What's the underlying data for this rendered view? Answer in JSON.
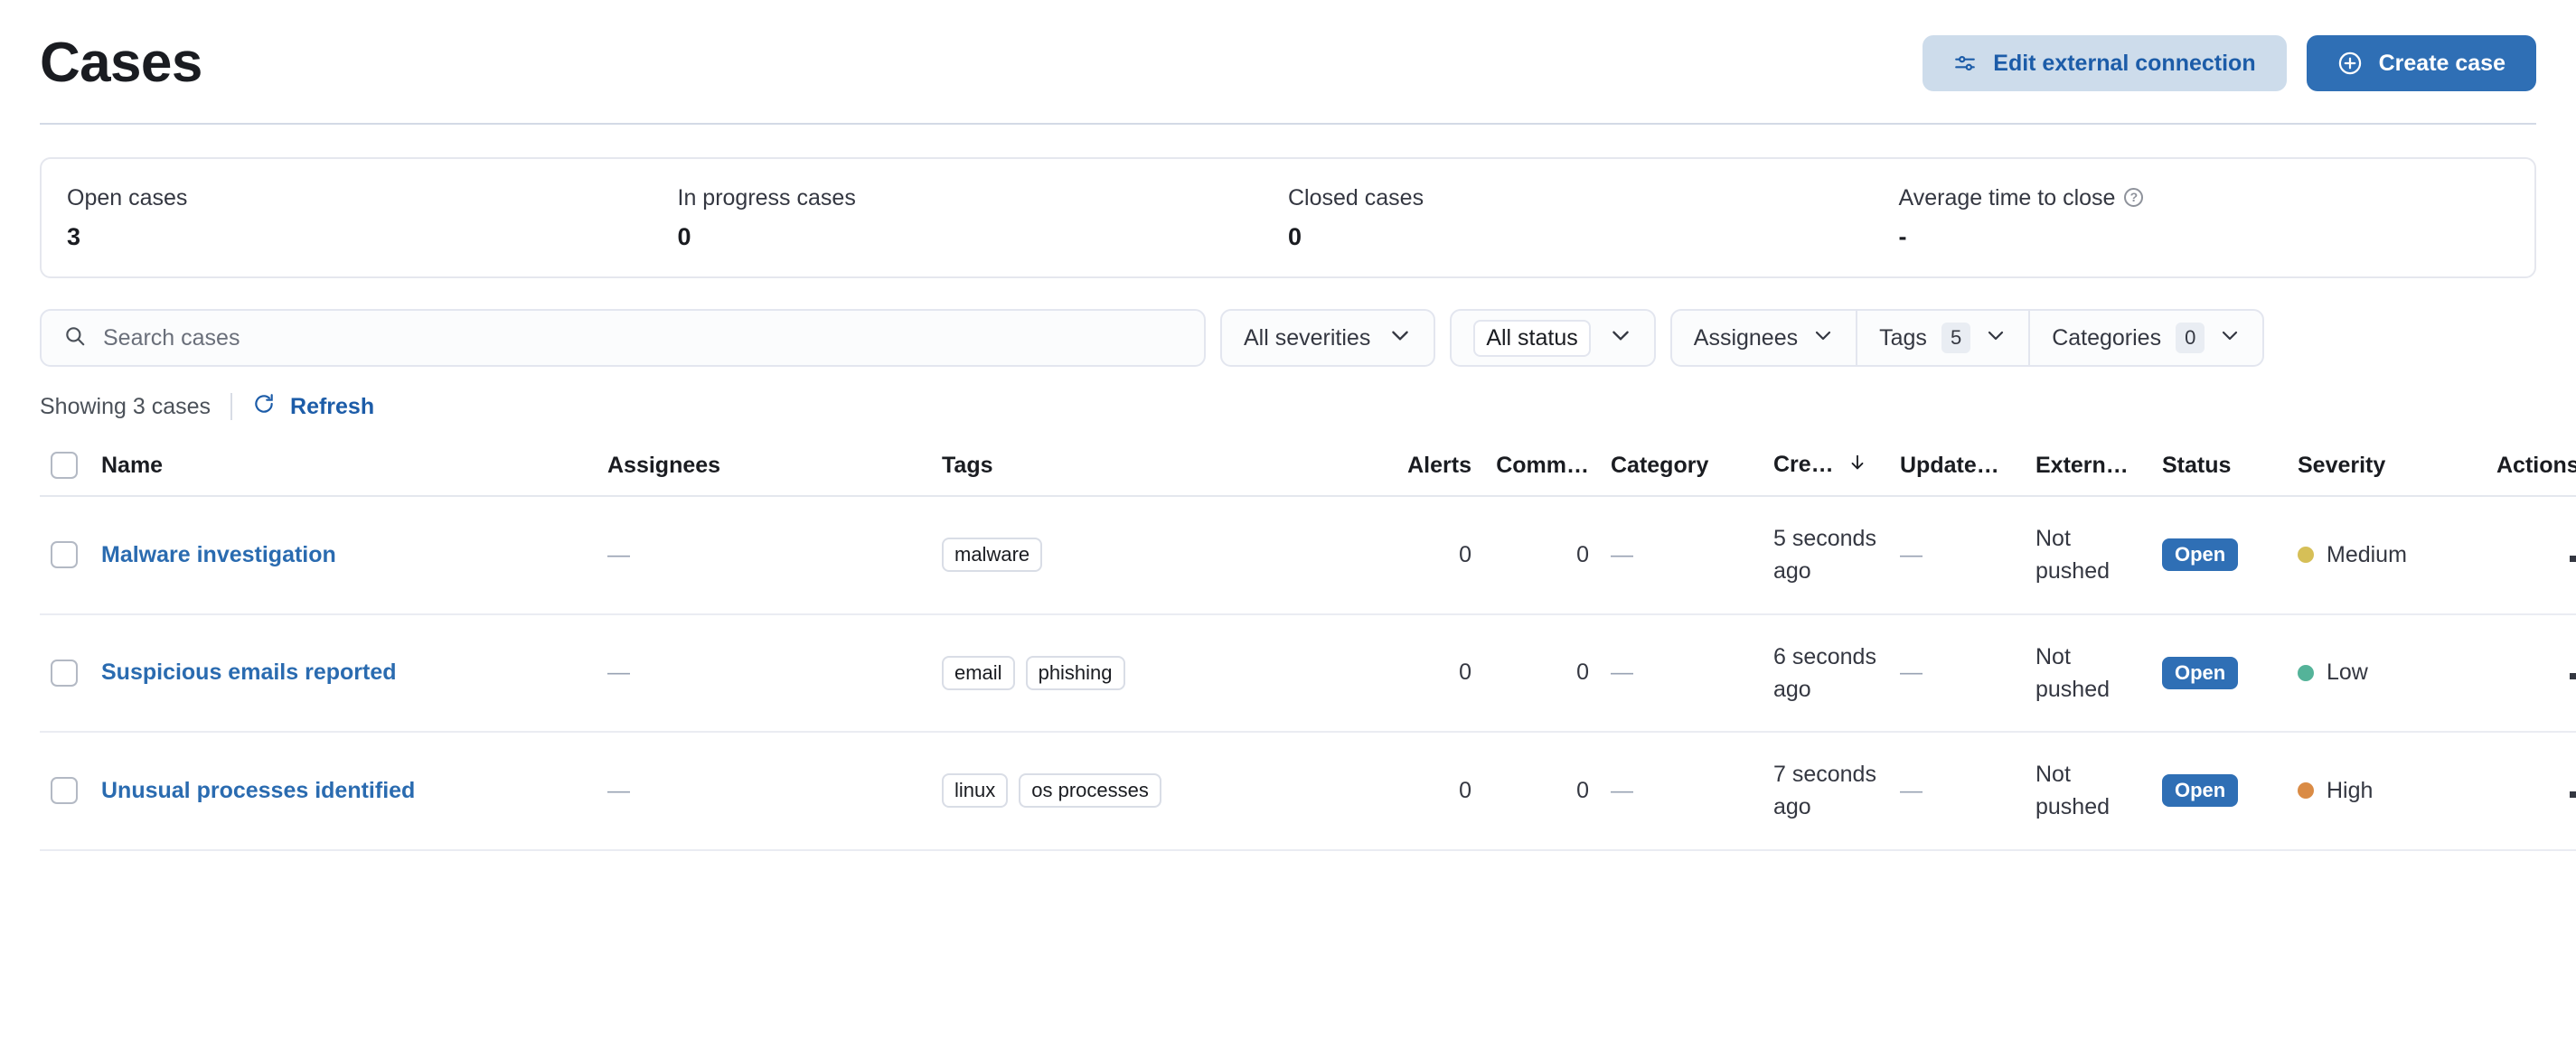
{
  "header": {
    "title": "Cases",
    "edit_connection_label": "Edit external connection",
    "edit_connection_icon": "sliders-icon",
    "create_case_label": "Create case",
    "create_case_icon": "plus-circle-icon"
  },
  "stats": [
    {
      "label": "Open cases",
      "value": "3",
      "help": false
    },
    {
      "label": "In progress cases",
      "value": "0",
      "help": false
    },
    {
      "label": "Closed cases",
      "value": "0",
      "help": false
    },
    {
      "label": "Average time to close",
      "value": "-",
      "help": true,
      "help_glyph": "?"
    }
  ],
  "filters": {
    "search_placeholder": "Search cases",
    "search_value": "",
    "search_icon": "search-icon",
    "severity_label": "All severities",
    "status_label": "All status",
    "assignees_label": "Assignees",
    "tags_label": "Tags",
    "tags_count": "5",
    "categories_label": "Categories",
    "categories_count": "0"
  },
  "list_meta": {
    "showing_text": "Showing 3 cases",
    "refresh_label": "Refresh",
    "refresh_icon": "refresh-icon"
  },
  "table": {
    "columns": [
      "Name",
      "Assignees",
      "Tags",
      "Alerts",
      "Comm…",
      "Category",
      "Cre…",
      "Update…",
      "Extern…",
      "Status",
      "Severity",
      "Actions"
    ],
    "sorted_column": "Cre…",
    "sort_direction": "desc",
    "rows": [
      {
        "name": "Malware investigation",
        "assignees": "—",
        "tags": [
          "malware"
        ],
        "alerts": "0",
        "comments": "0",
        "category": "—",
        "created": "5 seconds ago",
        "updated": "—",
        "external": "Not pushed",
        "status": "Open",
        "severity": "Medium",
        "severity_color": "#d6bf57"
      },
      {
        "name": "Suspicious emails reported",
        "assignees": "—",
        "tags": [
          "email",
          "phishing"
        ],
        "alerts": "0",
        "comments": "0",
        "category": "—",
        "created": "6 seconds ago",
        "updated": "—",
        "external": "Not pushed",
        "status": "Open",
        "severity": "Low",
        "severity_color": "#54b399"
      },
      {
        "name": "Unusual processes identified",
        "assignees": "—",
        "tags": [
          "linux",
          "os processes"
        ],
        "alerts": "0",
        "comments": "0",
        "category": "—",
        "created": "7 seconds ago",
        "updated": "—",
        "external": "Not pushed",
        "status": "Open",
        "severity": "High",
        "severity_color": "#da8b45"
      }
    ]
  },
  "colors": {
    "primary": "#2f6fb5",
    "link": "#2a6bb0",
    "secondary_btn_bg": "#cddceb"
  }
}
